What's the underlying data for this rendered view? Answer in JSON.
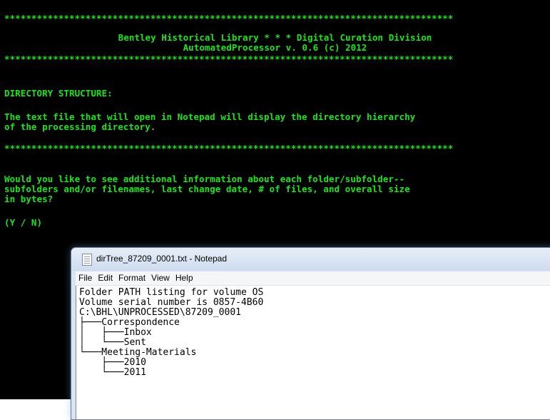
{
  "console": {
    "stars": "***********************************************************************************",
    "header_line1": "Bentley Historical Library * * * Digital Curation Division",
    "header_line2": "AutomatedProcessor v. 0.6 (c) 2012",
    "section_title": "DIRECTORY STRUCTURE:",
    "info_line1": "The text file that will open in Notepad will display the directory hierarchy",
    "info_line2": "of the processing directory.",
    "question_line1": "Would you like to see additional information about each folder/subfolder--",
    "question_line2": "subfolders and/or filenames, last change date, # of files, and overall size",
    "question_line3": "in bytes?",
    "prompt": "(Y / N)"
  },
  "notepad": {
    "title": "dirTree_87209_0001.txt - Notepad",
    "menu": [
      "File",
      "Edit",
      "Format",
      "View",
      "Help"
    ],
    "lines": [
      "Folder PATH listing for volume OS",
      "Volume serial number is 0857-4B60",
      "C:\\BHL\\UNPROCESSED\\87209_0001",
      "├───Correspondence",
      "│   ├───Inbox",
      "│   └───Sent",
      "└───Meeting-Materials",
      "    ├───2010",
      "    └───2011"
    ]
  },
  "colors": {
    "console_background": "#000000",
    "console_text": "#19e619"
  },
  "icons": {
    "notepad_window": "notepad-file-icon"
  }
}
